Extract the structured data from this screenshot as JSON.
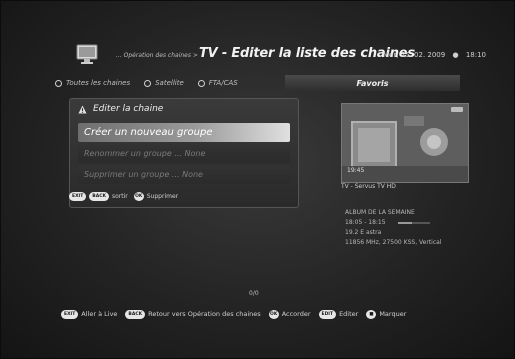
{
  "header": {
    "breadcrumb": "... Opération des chaines >",
    "title": "TV - Editer la liste des chaines",
    "date": "Mer, 25. 02. 2009",
    "time": "18:10"
  },
  "filters": [
    {
      "label": "Toutes les chaines"
    },
    {
      "label": "Satellite"
    },
    {
      "label": "FTA/CAS"
    }
  ],
  "favoris_label": "Favoris",
  "edit_panel": {
    "title": "Editer la chaine",
    "items": [
      {
        "label": "Créer un nouveau groupe",
        "state": "selected"
      },
      {
        "label": "Renommer un groupe ... None",
        "state": "disabled"
      },
      {
        "label": "Supprimer un groupe ... None",
        "state": "disabled"
      }
    ],
    "footer": {
      "exit_key": "EXIT",
      "back_key": "BACK",
      "exit_label": "sortir",
      "ok_key": "OK",
      "ok_label": "Supprimer"
    }
  },
  "preview": {
    "time": "19:45",
    "channel_name": "TV - Servus TV HD",
    "info": {
      "program": "ALBUM DE LA SEMAINE",
      "program_time": "18:05 - 18:15",
      "satellite": "19.2 E astra",
      "transponder": "11856 MHz, 27500 KSS, Vertical"
    },
    "progress": 0.45
  },
  "page_indicator": "0/0",
  "bottom_bar": {
    "exit_key": "EXIT",
    "exit_label": "Aller à Live",
    "back_key": "BACK",
    "back_label": "Retour vers Opération des chaines",
    "ok_key": "OK",
    "ok_label": "Accorder",
    "edit_key": "EDIT",
    "edit_label": "Editer",
    "mark_key": "■",
    "mark_label": "Marquer"
  },
  "colors": {
    "background": "#232323",
    "selected_highlight": "#e0e0e0",
    "accent_text": "#f2f2f2"
  }
}
